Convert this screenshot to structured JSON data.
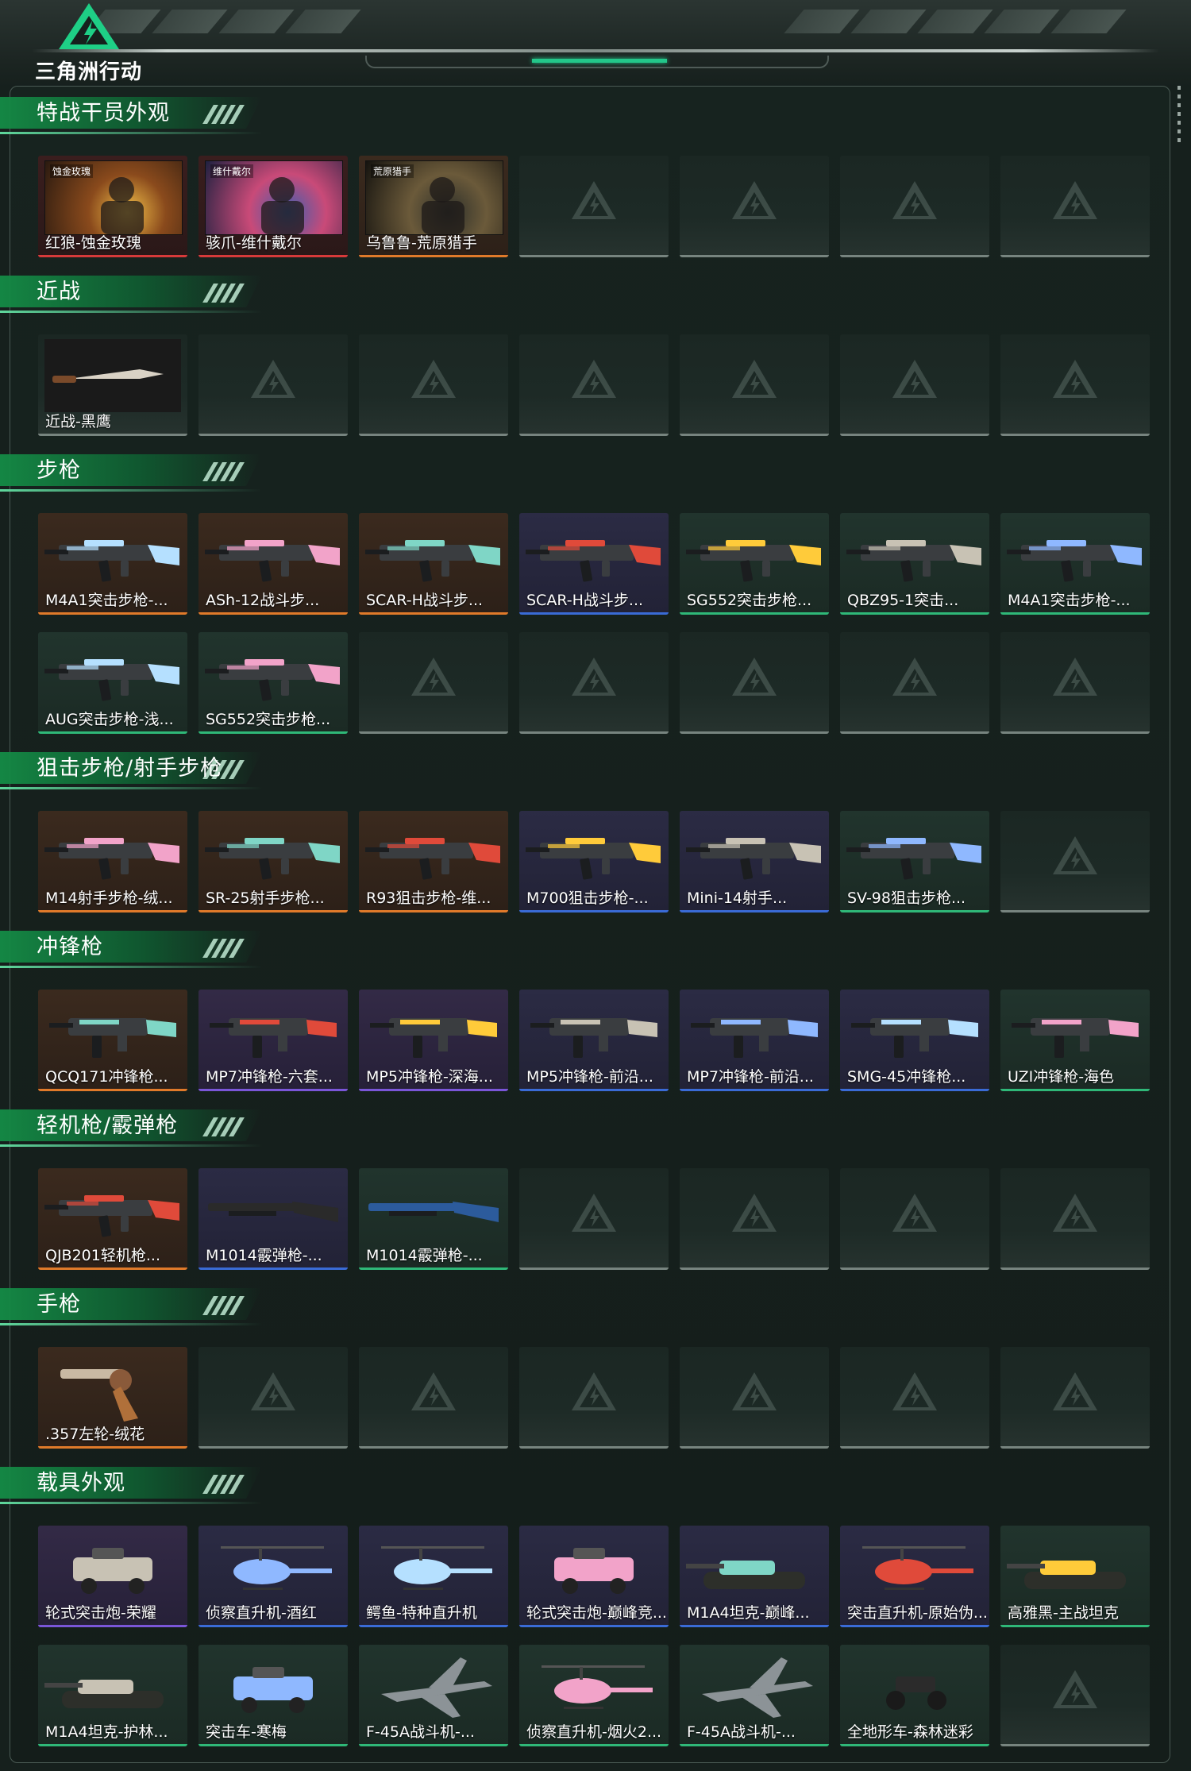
{
  "app": {
    "logo_text": "三角洲行动"
  },
  "sections": [
    {
      "title": "特战干员外观",
      "items": [
        {
          "label": "红狼-蚀金玫瑰",
          "quality": "red",
          "icon": "operator-portrait-icon",
          "tag": "蚀金玫瑰"
        },
        {
          "label": "骇爪-维什戴尔",
          "quality": "red",
          "icon": "operator-portrait-icon",
          "tag": "维什戴尔"
        },
        {
          "label": "乌鲁鲁-荒原猎手",
          "quality": "orange",
          "icon": "operator-portrait-icon",
          "tag": "荒原猎手"
        }
      ]
    },
    {
      "title": "近战",
      "items": [
        {
          "label": "近战-黑鹰",
          "quality": "none",
          "icon": "knife-icon"
        }
      ]
    },
    {
      "title": "步枪",
      "items": [
        {
          "label": "M4A1突击步枪-...",
          "quality": "orange",
          "icon": "rifle-icon"
        },
        {
          "label": "ASh-12战斗步...",
          "quality": "orange",
          "icon": "rifle-icon"
        },
        {
          "label": "SCAR-H战斗步...",
          "quality": "orange",
          "icon": "rifle-icon"
        },
        {
          "label": "SCAR-H战斗步...",
          "quality": "blue",
          "icon": "rifle-icon"
        },
        {
          "label": "SG552突击步枪...",
          "quality": "green",
          "icon": "rifle-icon"
        },
        {
          "label": "QBZ95-1突击...",
          "quality": "green",
          "icon": "rifle-icon"
        },
        {
          "label": "M4A1突击步枪-...",
          "quality": "green",
          "icon": "rifle-icon"
        },
        {
          "label": "AUG突击步枪-浅...",
          "quality": "green",
          "icon": "rifle-icon"
        },
        {
          "label": "SG552突击步枪...",
          "quality": "green",
          "icon": "rifle-icon"
        }
      ]
    },
    {
      "title": "狙击步枪/射手步枪",
      "items": [
        {
          "label": "M14射手步枪-绒...",
          "quality": "orange",
          "icon": "sniper-rifle-icon"
        },
        {
          "label": "SR-25射手步枪...",
          "quality": "orange",
          "icon": "sniper-rifle-icon"
        },
        {
          "label": "R93狙击步枪-维...",
          "quality": "orange",
          "icon": "sniper-rifle-icon"
        },
        {
          "label": "M700狙击步枪-...",
          "quality": "blue",
          "icon": "sniper-rifle-icon"
        },
        {
          "label": "Mini-14射手...",
          "quality": "blue",
          "icon": "sniper-rifle-icon"
        },
        {
          "label": "SV-98狙击步枪...",
          "quality": "green",
          "icon": "sniper-rifle-icon"
        }
      ]
    },
    {
      "title": "冲锋枪",
      "items": [
        {
          "label": "QCQ171冲锋枪...",
          "quality": "orange",
          "icon": "smg-icon"
        },
        {
          "label": "MP7冲锋枪-六套...",
          "quality": "purple",
          "icon": "smg-icon"
        },
        {
          "label": "MP5冲锋枪-深海...",
          "quality": "purple",
          "icon": "smg-icon"
        },
        {
          "label": "MP5冲锋枪-前沿...",
          "quality": "blue",
          "icon": "smg-icon"
        },
        {
          "label": "MP7冲锋枪-前沿...",
          "quality": "blue",
          "icon": "smg-icon"
        },
        {
          "label": "SMG-45冲锋枪...",
          "quality": "blue",
          "icon": "smg-icon"
        },
        {
          "label": "UZI冲锋枪-海色",
          "quality": "green",
          "icon": "smg-icon"
        }
      ]
    },
    {
      "title": "轻机枪/霰弹枪",
      "items": [
        {
          "label": "QJB201轻机枪...",
          "quality": "orange",
          "icon": "lmg-icon"
        },
        {
          "label": "M1014霰弹枪-...",
          "quality": "blue",
          "icon": "shotgun-icon"
        },
        {
          "label": "M1014霰弹枪-...",
          "quality": "green",
          "icon": "shotgun-icon"
        }
      ]
    },
    {
      "title": "手枪",
      "items": [
        {
          "label": ".357左轮-绒花",
          "quality": "orange",
          "icon": "revolver-icon"
        }
      ]
    },
    {
      "title": "载具外观",
      "items": [
        {
          "label": "轮式突击炮-荣耀",
          "quality": "purple",
          "icon": "armored-car-icon"
        },
        {
          "label": "侦察直升机-酒红",
          "quality": "blue",
          "icon": "helicopter-icon"
        },
        {
          "label": "鳄鱼-特种直升机",
          "quality": "blue",
          "icon": "helicopter-icon"
        },
        {
          "label": "轮式突击炮-巅峰竞...",
          "quality": "blue",
          "icon": "armored-car-icon"
        },
        {
          "label": "M1A4坦克-巅峰...",
          "quality": "blue",
          "icon": "tank-icon"
        },
        {
          "label": "突击直升机-原始伪...",
          "quality": "blue",
          "icon": "helicopter-icon"
        },
        {
          "label": "高雅黑-主战坦克",
          "quality": "green",
          "icon": "tank-icon"
        },
        {
          "label": "M1A4坦克-护林...",
          "quality": "green",
          "icon": "tank-icon"
        },
        {
          "label": "突击车-寒梅",
          "quality": "green",
          "icon": "armored-car-icon"
        },
        {
          "label": "F-45A战斗机-...",
          "quality": "green",
          "icon": "fighter-jet-icon"
        },
        {
          "label": "侦察直升机-烟火2...",
          "quality": "green",
          "icon": "helicopter-icon"
        },
        {
          "label": "F-45A战斗机-...",
          "quality": "green",
          "icon": "fighter-jet-icon"
        },
        {
          "label": "全地形车-森林迷彩",
          "quality": "green",
          "icon": "atv-icon"
        }
      ]
    }
  ],
  "colors": {
    "accent": "#2fb878",
    "quality_red": "#d73a3a",
    "quality_orange": "#e07a2a",
    "quality_blue": "#3a6bd6",
    "quality_purple": "#7a56d8",
    "quality_green": "#2fb878"
  }
}
